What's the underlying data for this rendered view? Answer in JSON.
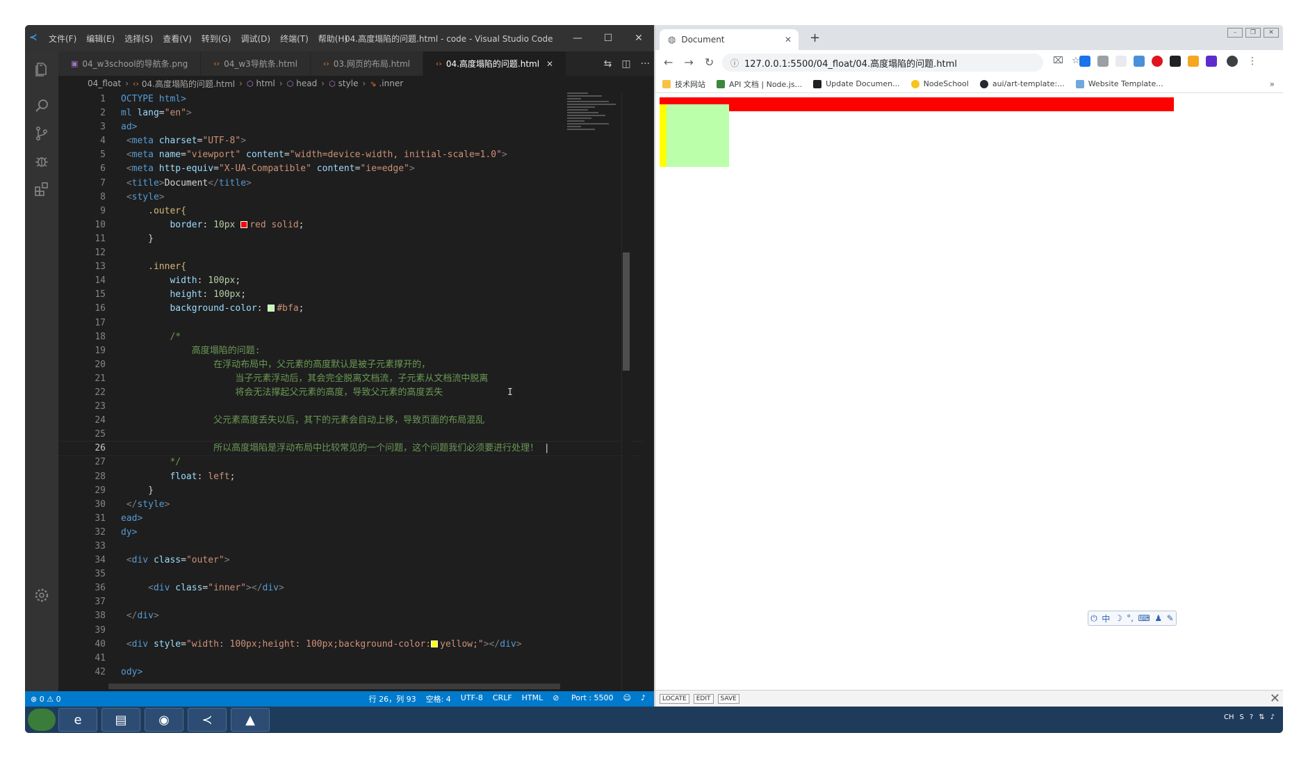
{
  "vscode": {
    "menu": [
      "文件(F)",
      "编辑(E)",
      "选择(S)",
      "查看(V)",
      "转到(G)",
      "调试(D)",
      "终端(T)",
      "帮助(H)"
    ],
    "window_title": "04.高度塌陷的问题.html - code - Visual Studio Code",
    "tabs": [
      {
        "label": "04_w3school的导航条.png",
        "type": "img"
      },
      {
        "label": "04_w3导航条.html",
        "type": "html"
      },
      {
        "label": "03.网页的布局.html",
        "type": "html"
      },
      {
        "label": "04.高度塌陷的问题.html",
        "type": "html",
        "active": true
      }
    ],
    "breadcrumb": [
      "04_float",
      "04.高度塌陷的问题.html",
      "html",
      "head",
      "style",
      ".inner"
    ],
    "lines": {
      "l1": "OCTYPE html>",
      "l2a": "ml ",
      "l2b": "lang",
      "l2c": "\"en\"",
      "l3": "ad>",
      "l4a": "charset",
      "l4b": "\"UTF-8\"",
      "l5a": "name",
      "l5b": "\"viewport\"",
      "l5c": "content",
      "l5d": "\"width=device-width, initial-scale=1.0\"",
      "l6a": "http-equiv",
      "l6b": "\"X-UA-Compatible\"",
      "l6c": "content",
      "l6d": "\"ie=edge\"",
      "l7": "Document",
      "l9": ".outer{",
      "l10a": "border",
      "l10b": "10px",
      "l10c": "red solid",
      "l13": ".inner{",
      "l14a": "width",
      "l14b": "100px",
      "l15a": "height",
      "l15b": "100px",
      "l16a": "background-color",
      "l16b": "#bfa",
      "l18": "/*",
      "l19": "高度塌陷的问题:",
      "l20": "在浮动布局中，父元素的高度默认是被子元素撑开的，",
      "l21": "当子元素浮动后，其会完全脱离文档流，子元素从文档流中脱离",
      "l22": "将会无法撑起父元素的高度，导致父元素的高度丢失",
      "l24": "父元素高度丢失以后，其下的元素会自动上移，导致页面的布局混乱",
      "l26": "所以高度塌陷是浮动布局中比较常见的一个问题，这个问题我们必须要进行处理！",
      "l27": "*/",
      "l28a": "float",
      "l28b": "left",
      "l31": "ead>",
      "l32": "dy>",
      "l34a": "class",
      "l34b": "\"outer\"",
      "l36a": "class",
      "l36b": "\"inner\"",
      "l40a": "style",
      "l40b": "\"width: 100px;height: 100px;background-color:",
      "l40c": "yellow;\"",
      "l42": "ody>"
    },
    "status": {
      "errors": "0",
      "warnings": "0",
      "position": "行 26，列 93",
      "spaces": "空格: 4",
      "encoding": "UTF-8",
      "eol": "CRLF",
      "language": "HTML",
      "port": "Port : 5500"
    }
  },
  "browser": {
    "tab_title": "Document",
    "url": "127.0.0.1:5500/04_float/04.高度塌陷的问题.html",
    "bookmarks": [
      "技术网站",
      "API 文档 | Node.js...",
      "Update Documen...",
      "NodeSchool",
      "aui/art-template:...",
      "Website Template..."
    ],
    "devbar": [
      "LOCATE",
      "EDIT",
      "SAVE"
    ],
    "ime": "中"
  },
  "colors": {
    "outer_border": "#ff0000",
    "inner_bg": "#bbffaa",
    "yellow_box": "#ffff00",
    "vscode_status": "#007acc"
  }
}
